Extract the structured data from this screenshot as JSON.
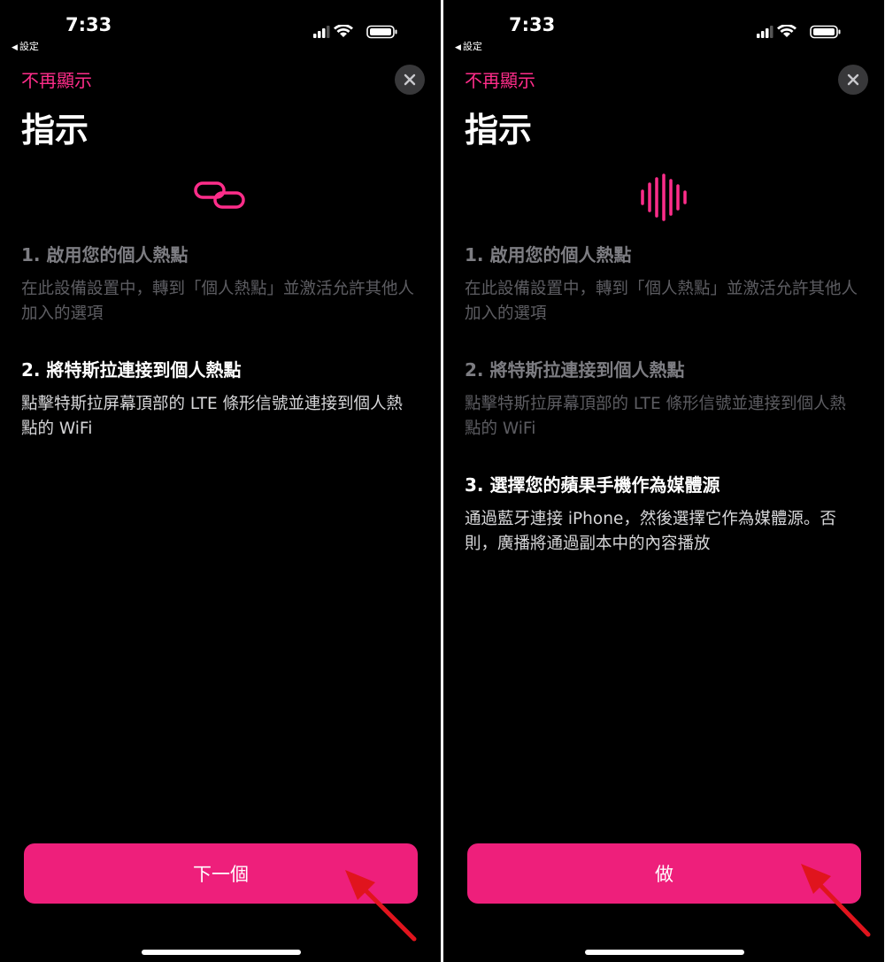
{
  "colors": {
    "accent": "#ff2d8a",
    "button": "#ee1f7b",
    "annotation_arrow": "#e0141d"
  },
  "screens": [
    {
      "status_bar": {
        "time": "7:33",
        "back_label": "設定"
      },
      "dont_show_again": "不再顯示",
      "title": "指示",
      "hero_icon": "link-icon",
      "steps": [
        {
          "title": "1. 啟用您的個人熱點",
          "body": "在此設備設置中，轉到「個人熱點」並激活允許其他人加入的選項",
          "state": "dim"
        },
        {
          "title": "2. 將特斯拉連接到個人熱點",
          "body": "點擊特斯拉屏幕頂部的 LTE 條形信號並連接到個人熱點的 WiFi",
          "state": "active"
        }
      ],
      "primary_button": "下一個"
    },
    {
      "status_bar": {
        "time": "7:33",
        "back_label": "設定"
      },
      "dont_show_again": "不再顯示",
      "title": "指示",
      "hero_icon": "audio-waveform-icon",
      "steps": [
        {
          "title": "1. 啟用您的個人熱點",
          "body": "在此設備設置中，轉到「個人熱點」並激活允許其他人加入的選項",
          "state": "dim"
        },
        {
          "title": "2. 將特斯拉連接到個人熱點",
          "body": "點擊特斯拉屏幕頂部的 LTE 條形信號並連接到個人熱點的 WiFi",
          "state": "dim"
        },
        {
          "title": "3. 選擇您的蘋果手機作為媒體源",
          "body": "通過藍牙連接 iPhone，然後選擇它作為媒體源。否則，廣播將通過副本中的內容播放",
          "state": "active"
        }
      ],
      "primary_button": "做"
    }
  ]
}
